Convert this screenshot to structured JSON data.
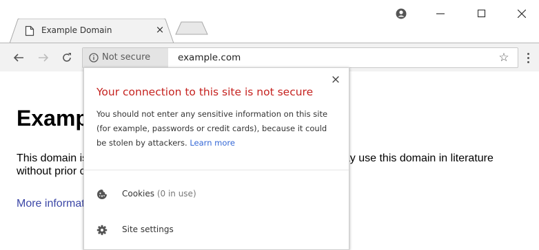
{
  "tab": {
    "title": "Example Domain",
    "close_glyph": "×"
  },
  "window": {
    "profile_icon": "profile-icon",
    "minimize_icon": "minimize-icon",
    "maximize_icon": "maximize-icon",
    "close_glyph": "✕"
  },
  "toolbar": {
    "security_label": "Not secure",
    "url": "example.com",
    "star_glyph": "☆"
  },
  "page": {
    "heading": "Example Domain",
    "paragraph": "This domain is for use in illustrative examples in documents. You may use this domain in literature without prior coordination or asking for permission.",
    "link": "More information..."
  },
  "popup": {
    "close_glyph": "×",
    "title": "Your connection to this site is not secure",
    "body": "You should not enter any sensitive information on this site (for example, passwords or credit cards), because it could be stolen by attackers.",
    "learn_more": "Learn more",
    "cookies_label": "Cookies",
    "cookies_count": "(0 in use)",
    "site_settings_label": "Site settings"
  },
  "colors": {
    "warning_red": "#c5221f",
    "link_blue": "#3367d6",
    "page_link": "#3b46a6"
  }
}
